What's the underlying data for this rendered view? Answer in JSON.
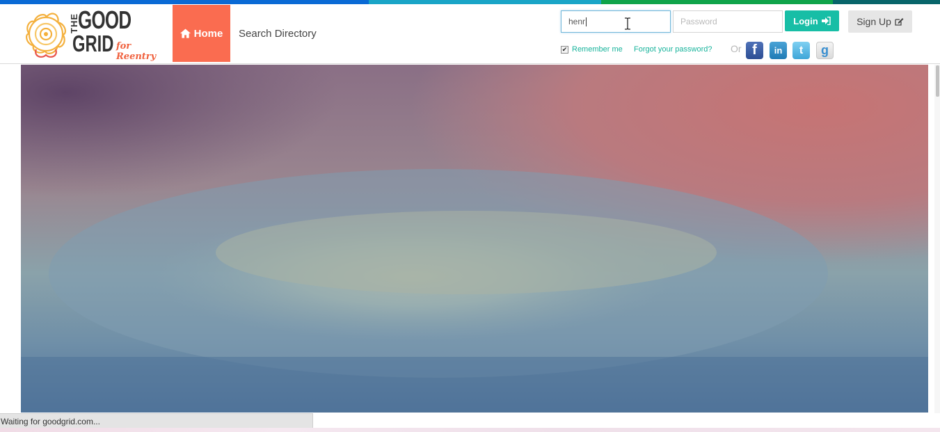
{
  "colors": {
    "stripe": [
      "#0a6ad5",
      "#1aa5c7",
      "#10a44a",
      "#08656a"
    ],
    "accent_home": "#fa6c50",
    "accent_teal": "#17bea6"
  },
  "logo": {
    "the": "THE",
    "good": "GOOD",
    "grid": "GRID",
    "tagline": "for Reentry"
  },
  "nav": {
    "home_label": "Home",
    "search_label": "Search Directory"
  },
  "login": {
    "username_value": "henr",
    "password_placeholder": "Password",
    "login_label": "Login",
    "signup_label": "Sign Up",
    "remember_label": "Remember me",
    "remember_checked": true,
    "forgot_label": "Forgot your password?",
    "or_label": "Or"
  },
  "social": [
    {
      "name": "facebook",
      "glyph": "f"
    },
    {
      "name": "linkedin",
      "glyph": "in"
    },
    {
      "name": "twitter",
      "glyph": "t"
    },
    {
      "name": "google",
      "glyph": "g"
    }
  ],
  "status": {
    "text": "Waiting for goodgrid.com..."
  }
}
